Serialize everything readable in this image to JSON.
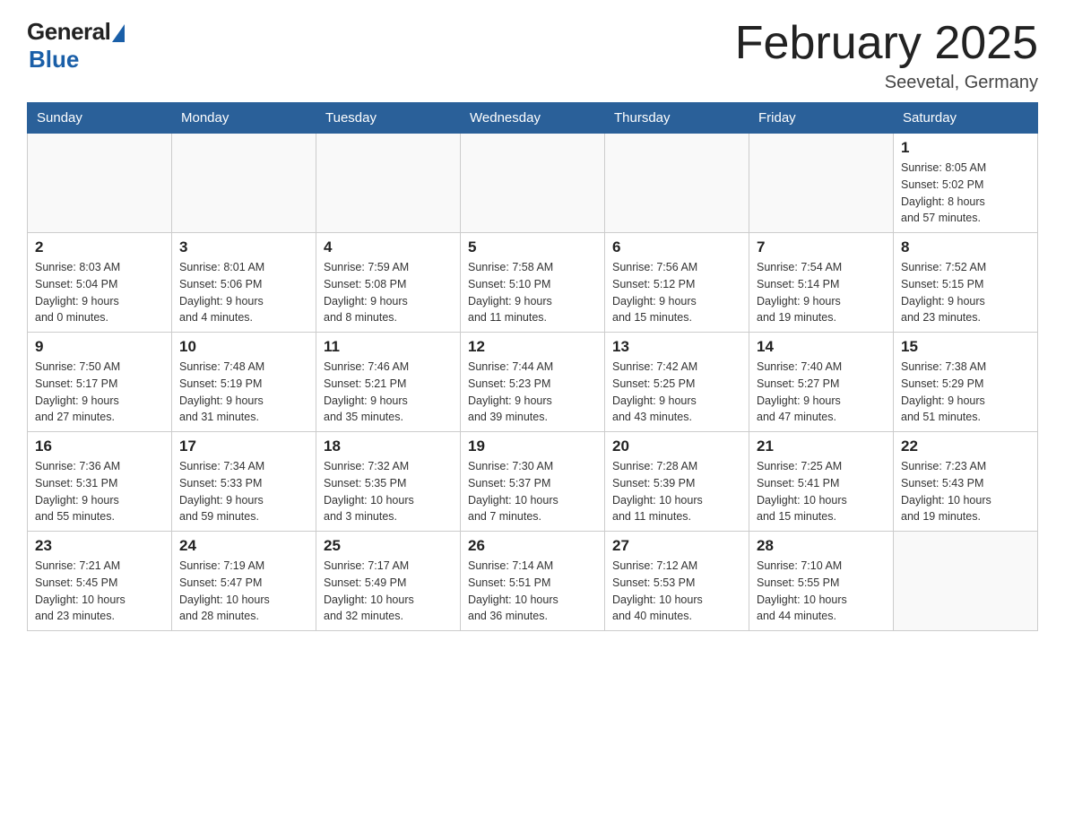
{
  "header": {
    "logo_general": "General",
    "logo_blue": "Blue",
    "title": "February 2025",
    "subtitle": "Seevetal, Germany"
  },
  "days_of_week": [
    "Sunday",
    "Monday",
    "Tuesday",
    "Wednesday",
    "Thursday",
    "Friday",
    "Saturday"
  ],
  "weeks": [
    {
      "days": [
        {
          "number": "",
          "info": ""
        },
        {
          "number": "",
          "info": ""
        },
        {
          "number": "",
          "info": ""
        },
        {
          "number": "",
          "info": ""
        },
        {
          "number": "",
          "info": ""
        },
        {
          "number": "",
          "info": ""
        },
        {
          "number": "1",
          "info": "Sunrise: 8:05 AM\nSunset: 5:02 PM\nDaylight: 8 hours\nand 57 minutes."
        }
      ]
    },
    {
      "days": [
        {
          "number": "2",
          "info": "Sunrise: 8:03 AM\nSunset: 5:04 PM\nDaylight: 9 hours\nand 0 minutes."
        },
        {
          "number": "3",
          "info": "Sunrise: 8:01 AM\nSunset: 5:06 PM\nDaylight: 9 hours\nand 4 minutes."
        },
        {
          "number": "4",
          "info": "Sunrise: 7:59 AM\nSunset: 5:08 PM\nDaylight: 9 hours\nand 8 minutes."
        },
        {
          "number": "5",
          "info": "Sunrise: 7:58 AM\nSunset: 5:10 PM\nDaylight: 9 hours\nand 11 minutes."
        },
        {
          "number": "6",
          "info": "Sunrise: 7:56 AM\nSunset: 5:12 PM\nDaylight: 9 hours\nand 15 minutes."
        },
        {
          "number": "7",
          "info": "Sunrise: 7:54 AM\nSunset: 5:14 PM\nDaylight: 9 hours\nand 19 minutes."
        },
        {
          "number": "8",
          "info": "Sunrise: 7:52 AM\nSunset: 5:15 PM\nDaylight: 9 hours\nand 23 minutes."
        }
      ]
    },
    {
      "days": [
        {
          "number": "9",
          "info": "Sunrise: 7:50 AM\nSunset: 5:17 PM\nDaylight: 9 hours\nand 27 minutes."
        },
        {
          "number": "10",
          "info": "Sunrise: 7:48 AM\nSunset: 5:19 PM\nDaylight: 9 hours\nand 31 minutes."
        },
        {
          "number": "11",
          "info": "Sunrise: 7:46 AM\nSunset: 5:21 PM\nDaylight: 9 hours\nand 35 minutes."
        },
        {
          "number": "12",
          "info": "Sunrise: 7:44 AM\nSunset: 5:23 PM\nDaylight: 9 hours\nand 39 minutes."
        },
        {
          "number": "13",
          "info": "Sunrise: 7:42 AM\nSunset: 5:25 PM\nDaylight: 9 hours\nand 43 minutes."
        },
        {
          "number": "14",
          "info": "Sunrise: 7:40 AM\nSunset: 5:27 PM\nDaylight: 9 hours\nand 47 minutes."
        },
        {
          "number": "15",
          "info": "Sunrise: 7:38 AM\nSunset: 5:29 PM\nDaylight: 9 hours\nand 51 minutes."
        }
      ]
    },
    {
      "days": [
        {
          "number": "16",
          "info": "Sunrise: 7:36 AM\nSunset: 5:31 PM\nDaylight: 9 hours\nand 55 minutes."
        },
        {
          "number": "17",
          "info": "Sunrise: 7:34 AM\nSunset: 5:33 PM\nDaylight: 9 hours\nand 59 minutes."
        },
        {
          "number": "18",
          "info": "Sunrise: 7:32 AM\nSunset: 5:35 PM\nDaylight: 10 hours\nand 3 minutes."
        },
        {
          "number": "19",
          "info": "Sunrise: 7:30 AM\nSunset: 5:37 PM\nDaylight: 10 hours\nand 7 minutes."
        },
        {
          "number": "20",
          "info": "Sunrise: 7:28 AM\nSunset: 5:39 PM\nDaylight: 10 hours\nand 11 minutes."
        },
        {
          "number": "21",
          "info": "Sunrise: 7:25 AM\nSunset: 5:41 PM\nDaylight: 10 hours\nand 15 minutes."
        },
        {
          "number": "22",
          "info": "Sunrise: 7:23 AM\nSunset: 5:43 PM\nDaylight: 10 hours\nand 19 minutes."
        }
      ]
    },
    {
      "days": [
        {
          "number": "23",
          "info": "Sunrise: 7:21 AM\nSunset: 5:45 PM\nDaylight: 10 hours\nand 23 minutes."
        },
        {
          "number": "24",
          "info": "Sunrise: 7:19 AM\nSunset: 5:47 PM\nDaylight: 10 hours\nand 28 minutes."
        },
        {
          "number": "25",
          "info": "Sunrise: 7:17 AM\nSunset: 5:49 PM\nDaylight: 10 hours\nand 32 minutes."
        },
        {
          "number": "26",
          "info": "Sunrise: 7:14 AM\nSunset: 5:51 PM\nDaylight: 10 hours\nand 36 minutes."
        },
        {
          "number": "27",
          "info": "Sunrise: 7:12 AM\nSunset: 5:53 PM\nDaylight: 10 hours\nand 40 minutes."
        },
        {
          "number": "28",
          "info": "Sunrise: 7:10 AM\nSunset: 5:55 PM\nDaylight: 10 hours\nand 44 minutes."
        },
        {
          "number": "",
          "info": ""
        }
      ]
    }
  ]
}
